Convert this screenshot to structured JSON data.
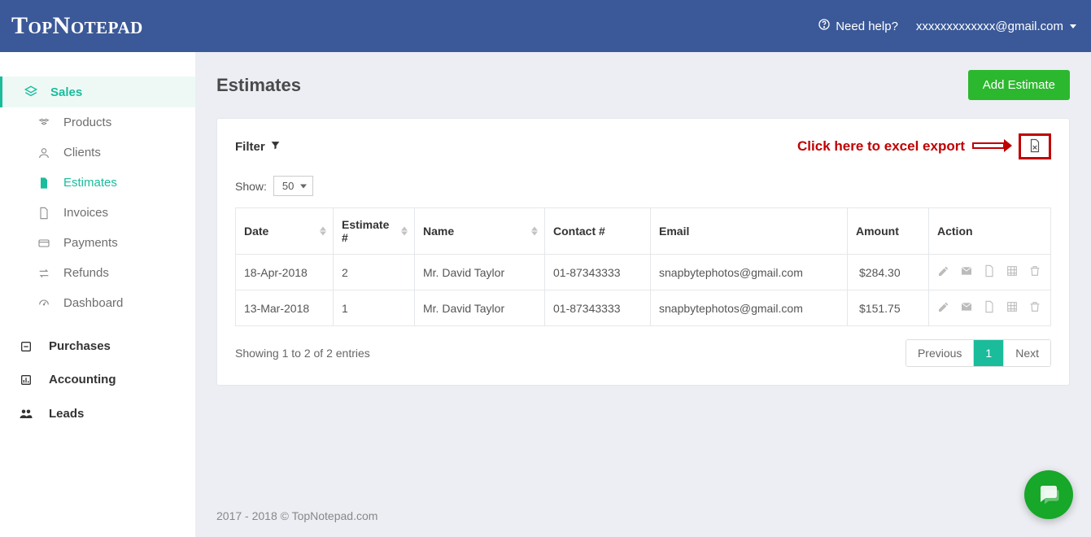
{
  "brand": "TopNotepad",
  "topbar": {
    "help_label": "Need help?",
    "user_email": "xxxxxxxxxxxxx@gmail.com"
  },
  "sidebar": {
    "sections": [
      {
        "label": "Sales",
        "key": "sales",
        "active": true
      },
      {
        "label": "Purchases",
        "key": "purchases",
        "active": false
      },
      {
        "label": "Accounting",
        "key": "accounting",
        "active": false
      },
      {
        "label": "Leads",
        "key": "leads",
        "active": false
      }
    ],
    "sales_items": [
      {
        "label": "Products",
        "active": false
      },
      {
        "label": "Clients",
        "active": false
      },
      {
        "label": "Estimates",
        "active": true
      },
      {
        "label": "Invoices",
        "active": false
      },
      {
        "label": "Payments",
        "active": false
      },
      {
        "label": "Refunds",
        "active": false
      },
      {
        "label": "Dashboard",
        "active": false
      }
    ]
  },
  "page": {
    "title": "Estimates",
    "add_button": "Add Estimate",
    "filter_label": "Filter",
    "export_hint": "Click here to excel export",
    "show_label": "Show:",
    "show_value": "50",
    "columns": {
      "date": "Date",
      "estimate_no": "Estimate #",
      "name": "Name",
      "contact": "Contact #",
      "email": "Email",
      "amount": "Amount",
      "action": "Action"
    },
    "rows": [
      {
        "date": "18-Apr-2018",
        "estimate_no": "2",
        "name": "Mr. David Taylor",
        "contact": "01-87343333",
        "email": "snapbytephotos@gmail.com",
        "currency": "$",
        "amount": "284.30"
      },
      {
        "date": "13-Mar-2018",
        "estimate_no": "1",
        "name": "Mr. David Taylor",
        "contact": "01-87343333",
        "email": "snapbytephotos@gmail.com",
        "currency": "$",
        "amount": "151.75"
      }
    ],
    "entries_text": "Showing 1 to 2 of 2 entries",
    "pager": {
      "prev": "Previous",
      "next": "Next",
      "pages": [
        "1"
      ],
      "current": "1"
    }
  },
  "footer": "2017 - 2018 © TopNotepad.com"
}
